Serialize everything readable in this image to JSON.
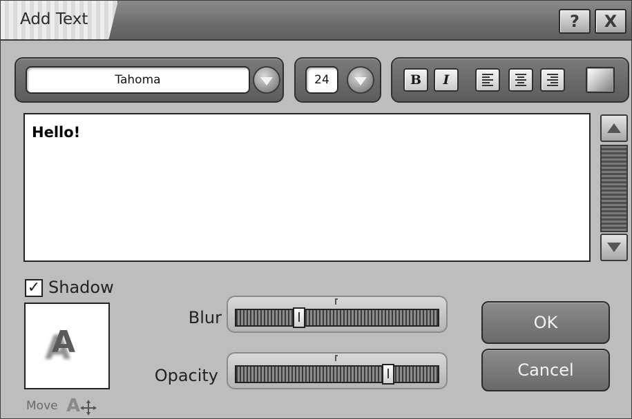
{
  "window": {
    "title": "Add Text",
    "help_label": "?",
    "close_label": "X"
  },
  "toolbar": {
    "font_name": "Tahoma",
    "font_size": "24",
    "bold_label": "B",
    "italic_label": "I",
    "color_swatch": "#9a9a9a"
  },
  "editor": {
    "text": "Hello!"
  },
  "shadow": {
    "checkbox_label": "Shadow",
    "checked": true,
    "check_mark": "✓",
    "preview_letter": "A",
    "move_label": "Move"
  },
  "sliders": {
    "blur": {
      "label": "Blur",
      "value": 0.3
    },
    "opacity": {
      "label": "Opacity",
      "value": 0.77
    }
  },
  "buttons": {
    "ok_label": "OK",
    "cancel_label": "Cancel"
  }
}
